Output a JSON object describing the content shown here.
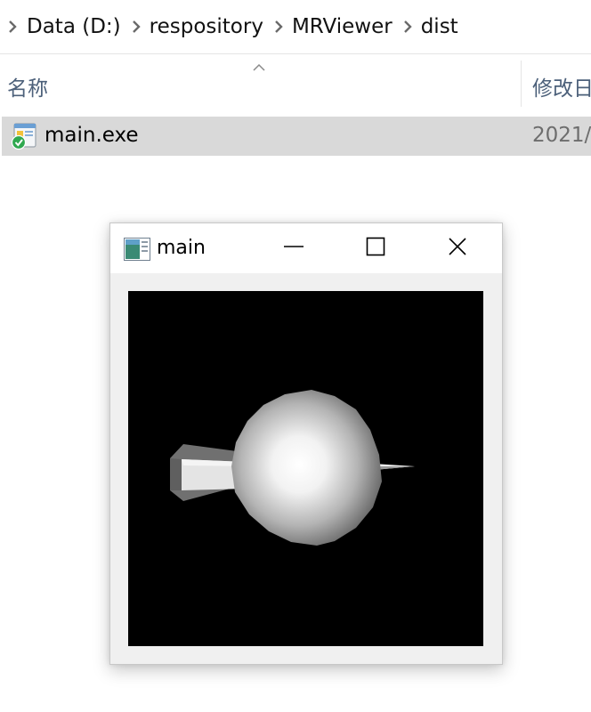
{
  "breadcrumb": {
    "items": [
      "Data (D:)",
      "respository",
      "MRViewer",
      "dist"
    ]
  },
  "columns": {
    "name": "名称",
    "modified": "修改日"
  },
  "file": {
    "name": "main.exe",
    "date": "2021/"
  },
  "window": {
    "title": "main"
  },
  "icons": {
    "breadcrumb_separator": "chevron-right-icon",
    "sort": "sort-up-icon",
    "file": "exe-icon",
    "app": "app-window-icon",
    "minimize": "minimize-icon",
    "maximize": "maximize-icon",
    "close": "close-icon"
  },
  "colors": {
    "selected_row": "#d9d9d9",
    "column_header_text": "#4c607a",
    "viewport_background": "#000000",
    "window_frame": "#f0f0f0"
  }
}
